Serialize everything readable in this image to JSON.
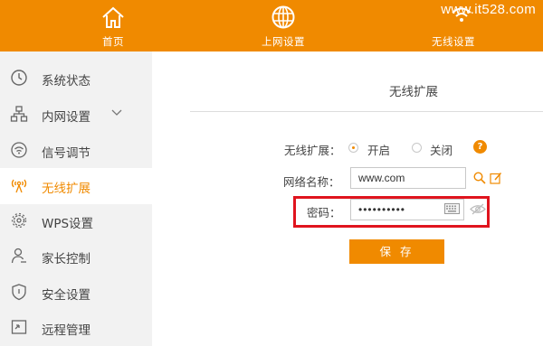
{
  "header": {
    "nav": [
      {
        "label": "首页",
        "icon": "home-icon"
      },
      {
        "label": "上网设置",
        "icon": "globe-icon"
      },
      {
        "label": "无线设置",
        "icon": "wifi-icon"
      }
    ],
    "watermark": "www.it528.com"
  },
  "sidebar": {
    "items": [
      {
        "label": "系统状态",
        "icon": "clock-icon"
      },
      {
        "label": "内网设置",
        "icon": "network-icon"
      },
      {
        "label": "信号调节",
        "icon": "signal-icon"
      },
      {
        "label": "无线扩展",
        "icon": "wifi-extend-icon",
        "active": true
      },
      {
        "label": "WPS设置",
        "icon": "gear-icon"
      },
      {
        "label": "家长控制",
        "icon": "user-icon"
      },
      {
        "label": "安全设置",
        "icon": "shield-icon"
      },
      {
        "label": "远程管理",
        "icon": "remote-icon"
      }
    ]
  },
  "main": {
    "title": "无线扩展",
    "extension": {
      "label": "无线扩展：",
      "on_label": "开启",
      "off_label": "关闭",
      "selected": "on",
      "help": "?"
    },
    "ssid": {
      "label": "网络名称：",
      "value": "www.com"
    },
    "password": {
      "label": "密码：",
      "value": "••••••••••"
    },
    "save_label": "保 存"
  },
  "colors": {
    "accent": "#f08a00",
    "highlight": "#e0141e",
    "sidebar_bg": "#f2f2f2"
  }
}
